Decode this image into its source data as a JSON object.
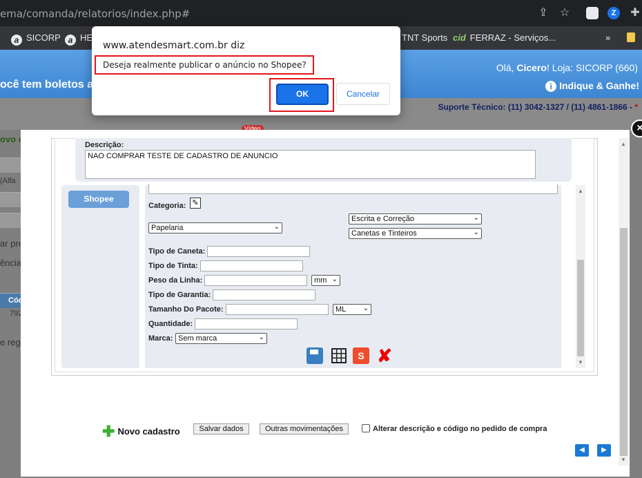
{
  "browser": {
    "url": "ema/comanda/relatorios/index.php#",
    "bookmarks": [
      {
        "label": "SICORP",
        "icon": "a"
      },
      {
        "label": "HE",
        "icon": "a"
      },
      {
        "label": "TNT Sports",
        "icon": ""
      },
      {
        "label": "FERRAZ - Serviços...",
        "icon": "cid"
      }
    ],
    "more": "»"
  },
  "page": {
    "boletos": "ocê tem boletos a",
    "ola_prefix": "Olá, ",
    "ola_name": "Cicero",
    "ola_suffix": "!  Loja: SICORP (660)",
    "indique": "Indique & Ganhe!",
    "suporte": "Suporte Técnico: (11) 3042-1327 / (11) 4861-1866 - ",
    "suporte_star": "*",
    "bg": {
      "video": "Vídeo",
      "novo": "ovo ca",
      "alfa": "(Alfa",
      "pre": "ar pre",
      "gencia": "ência",
      "co": "Cód",
      "n792": "792",
      "reg": "e reg"
    }
  },
  "modal": {
    "close": "×",
    "descricao_label": "Descrição:",
    "descricao_value": "NAO COMPRAR TESTE DE CADASTRO DE ANUNCIO",
    "shopee_tab": "Shopee",
    "categoria_label": "Categoria:",
    "categoria_select": "Papelaria",
    "subcat1": "Escrita e Correção",
    "subcat2": "Canetas e Tinteiros",
    "fields": {
      "tipo_caneta": "Tipo de Caneta:",
      "tipo_tinta": "Tipo de Tinta:",
      "peso_linha": "Peso da Linha:",
      "peso_unit": "mm",
      "tipo_garantia": "Tipo de Garantia:",
      "tamanho_pacote": "Tamanho Do Pacote:",
      "tamanho_unit": "ML",
      "quantidade": "Quantidade:",
      "marca": "Marca:",
      "marca_value": "Sem marca"
    },
    "shopee_icon": "S",
    "delete_icon": "✘",
    "footer": {
      "novo": "Novo cadastro",
      "salvar": "Salvar dados",
      "outras": "Outras movimentações",
      "alterar": "Alterar descrição e código no pedido de compra",
      "prev": "◀",
      "next": "▶"
    }
  },
  "dialog": {
    "origin": "www.atendesmart.com.br diz",
    "message": "Deseja realmente publicar o anúncio no Shopee?",
    "ok": "OK",
    "cancel": "Cancelar"
  }
}
